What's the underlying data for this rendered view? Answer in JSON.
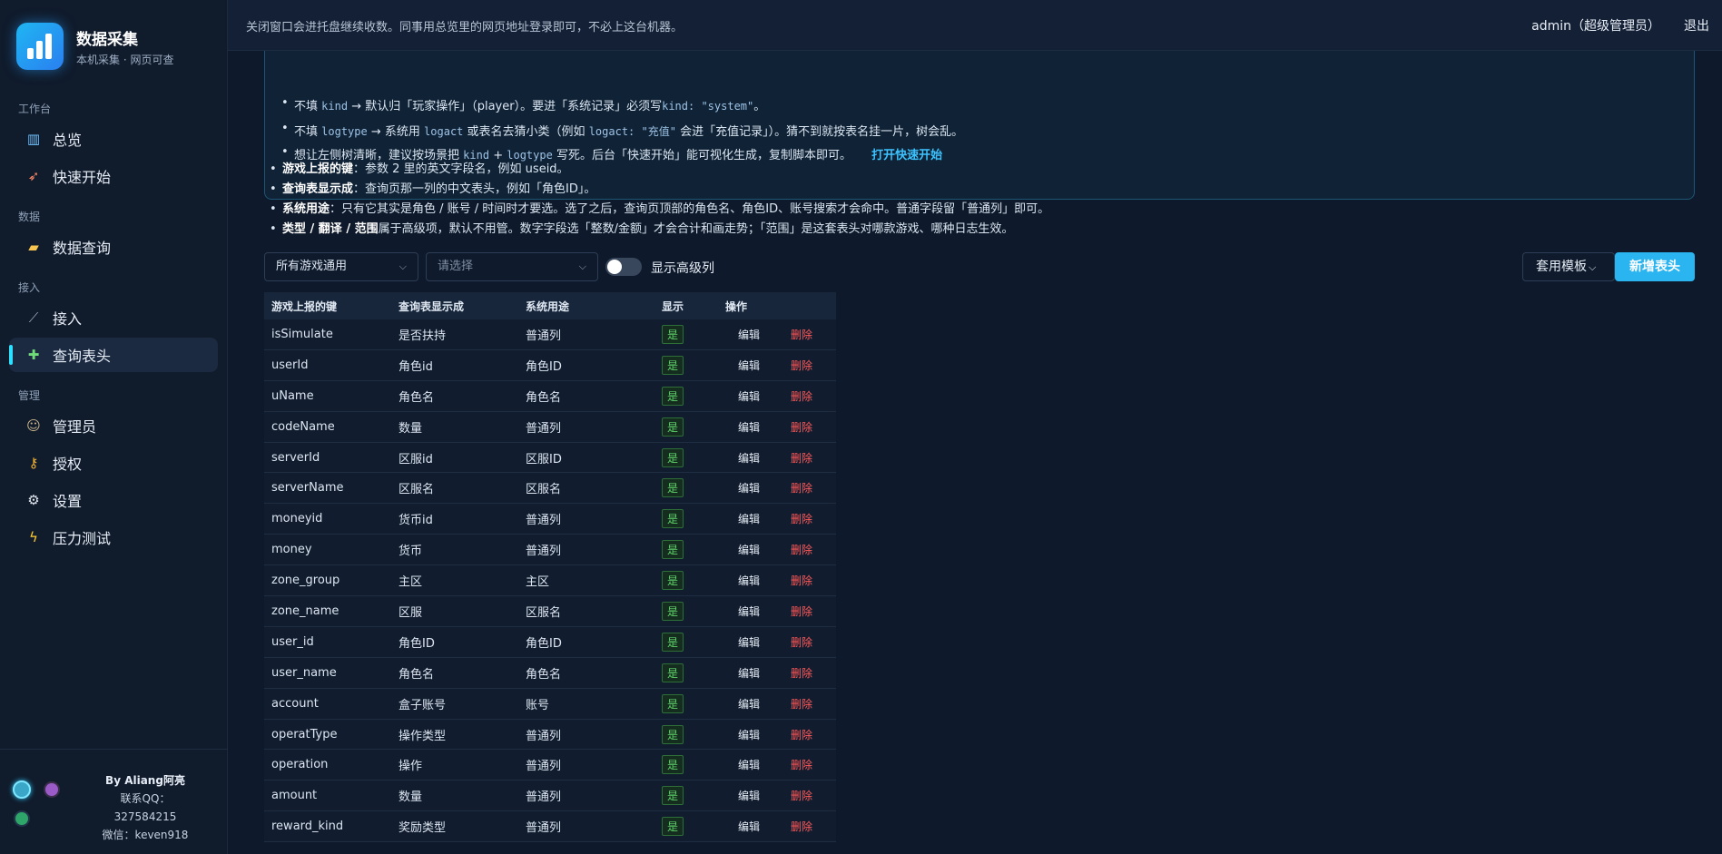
{
  "brand": {
    "title": "数据采集",
    "subtitle": "本机采集 · 网页可查"
  },
  "sidebar": {
    "sections": [
      "工作台",
      "数据",
      "接入",
      "管理"
    ],
    "items": [
      {
        "label": "总览",
        "icon": "chart-icon"
      },
      {
        "label": "快速开始",
        "icon": "rocket-icon"
      },
      {
        "label": "数据查询",
        "icon": "folder-icon"
      },
      {
        "label": "接入",
        "icon": "plug-icon"
      },
      {
        "label": "查询表头",
        "icon": "puzzle-icon",
        "active": true
      },
      {
        "label": "管理员",
        "icon": "person-icon"
      },
      {
        "label": "授权",
        "icon": "key-icon"
      },
      {
        "label": "设置",
        "icon": "gear-icon"
      },
      {
        "label": "压力测试",
        "icon": "lightning-icon"
      }
    ],
    "author": {
      "by": "By Aliang阿亮",
      "qq_label": "联系QQ：",
      "qq": "327584215",
      "wechat": "微信：keven918"
    }
  },
  "topbar": {
    "notice": "关闭窗口会进托盘继续收数。同事用总览里的网页地址登录即可，不必上这台机器。",
    "user": "admin（超级管理员）",
    "logout": "退出"
  },
  "info": {
    "line1_a": "不填",
    "line1_code1": "kind",
    "line1_b": "→ 默认归「玩家操作」（player）。要进「系统记录」必须写",
    "line1_code2": "kind: \"system\"",
    "line1_c": "。",
    "line2_a": "不填",
    "line2_code1": "logtype",
    "line2_b": "→ 系统用",
    "line2_code2": "logact",
    "line2_c": "或表名去猜小类（例如",
    "line2_code3": "logact: \"充值\"",
    "line2_d": "会进「充值记录」）。猜不到就按表名挂一片，树会乱。",
    "line3_a": "想让左侧树清晰，建议按场景把",
    "line3_code1": "kind",
    "line3_plus": "+",
    "line3_code2": "logtype",
    "line3_b": "写死。后台「快速开始」能可视化生成，复制脚本即可。",
    "link": "打开快速开始"
  },
  "bullets": [
    {
      "bold": "游戏上报的键",
      "text": "：参数 2 里的英文字段名，例如 useid。"
    },
    {
      "bold": "查询表显示成",
      "text": "：查询页那一列的中文表头，例如「角色ID」。"
    },
    {
      "bold": "系统用途",
      "text": "：只有它其实是角色 / 账号 / 时间时才要选。选了之后，查询页顶部的角色名、角色ID、账号搜索才会命中。普通字段留「普通列」即可。"
    },
    {
      "bold": "类型 / 翻译 / 范围",
      "text": "属于高级项，默认不用管。数字字段选「整数/金额」才会合计和画走势；「范围」是这套表头对哪款游戏、哪种日志生效。"
    }
  ],
  "toolbar": {
    "game_select": "所有游戏通用",
    "second_select_placeholder": "请选择",
    "toggle_label": "显示高级列",
    "template_button": "套用模板",
    "add_button": "新增表头"
  },
  "table": {
    "headers": [
      "游戏上报的键",
      "查询表显示成",
      "系统用途",
      "显示",
      "操作"
    ],
    "edit_label": "编辑",
    "delete_label": "删除",
    "rows": [
      {
        "key": "isSimulate",
        "display": "是否扶持",
        "usage": "普通列",
        "show": "是"
      },
      {
        "key": "userId",
        "display": "角色id",
        "usage": "角色ID",
        "show": "是"
      },
      {
        "key": "uName",
        "display": "角色名",
        "usage": "角色名",
        "show": "是"
      },
      {
        "key": "codeName",
        "display": "数量",
        "usage": "普通列",
        "show": "是"
      },
      {
        "key": "serverId",
        "display": "区服id",
        "usage": "区服ID",
        "show": "是"
      },
      {
        "key": "serverName",
        "display": "区服名",
        "usage": "区服名",
        "show": "是"
      },
      {
        "key": "moneyid",
        "display": "货币id",
        "usage": "普通列",
        "show": "是"
      },
      {
        "key": "money",
        "display": "货币",
        "usage": "普通列",
        "show": "是"
      },
      {
        "key": "zone_group",
        "display": "主区",
        "usage": "主区",
        "show": "是"
      },
      {
        "key": "zone_name",
        "display": "区服",
        "usage": "区服名",
        "show": "是"
      },
      {
        "key": "user_id",
        "display": "角色ID",
        "usage": "角色ID",
        "show": "是"
      },
      {
        "key": "user_name",
        "display": "角色名",
        "usage": "角色名",
        "show": "是"
      },
      {
        "key": "account",
        "display": "盒子账号",
        "usage": "账号",
        "show": "是"
      },
      {
        "key": "operatType",
        "display": "操作类型",
        "usage": "普通列",
        "show": "是"
      },
      {
        "key": "operation",
        "display": "操作",
        "usage": "普通列",
        "show": "是"
      },
      {
        "key": "amount",
        "display": "数量",
        "usage": "普通列",
        "show": "是"
      },
      {
        "key": "reward_kind",
        "display": "奖励类型",
        "usage": "普通列",
        "show": "是"
      }
    ]
  },
  "colors": {
    "accent": "#2ab5f1",
    "danger": "#ff5a5a",
    "success": "#5fd36a"
  }
}
